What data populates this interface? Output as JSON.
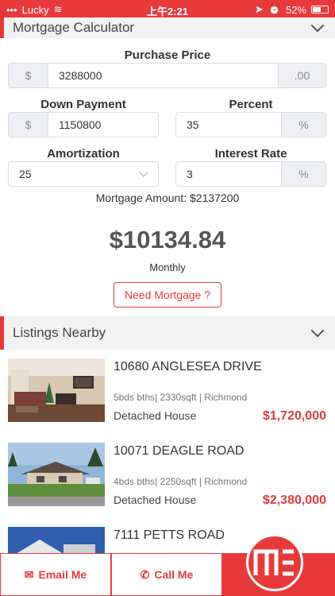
{
  "status_bar": {
    "carrier": "Lucky",
    "time": "上午2:21",
    "battery": "52%"
  },
  "calculator": {
    "title": "Mortgage Calculator",
    "purchase_price": {
      "label": "Purchase Price",
      "prefix": "$",
      "value": "3288000",
      "suffix": ".00"
    },
    "down_payment": {
      "label": "Down Payment",
      "prefix": "$",
      "value": "1150800"
    },
    "percent": {
      "label": "Percent",
      "value": "35",
      "suffix": "%"
    },
    "amortization": {
      "label": "Amortization",
      "value": "25"
    },
    "interest_rate": {
      "label": "Interest Rate",
      "value": "3",
      "suffix": "%"
    },
    "mortgage_amount": "Mortgage Amount: $2137200",
    "monthly_payment": "$10134.84",
    "monthly_label": "Monthly",
    "need_mortgage": "Need Mortgage ?"
  },
  "listings": {
    "title": "Listings Nearby",
    "items": [
      {
        "address": "10680 ANGLESEA DRIVE",
        "meta": "5bds bths| 2330sqft | Richmond",
        "type": "Detached House",
        "price": "$1,720,000"
      },
      {
        "address": "10071 DEAGLE ROAD",
        "meta": "4bds bths| 2250sqft | Richmond",
        "type": "Detached House",
        "price": "$2,380,000"
      },
      {
        "address": "7111 PETTS ROAD"
      }
    ]
  },
  "bottom_bar": {
    "email": "Email Me",
    "call": "Call Me"
  },
  "colors": {
    "accent": "#e8393a"
  }
}
